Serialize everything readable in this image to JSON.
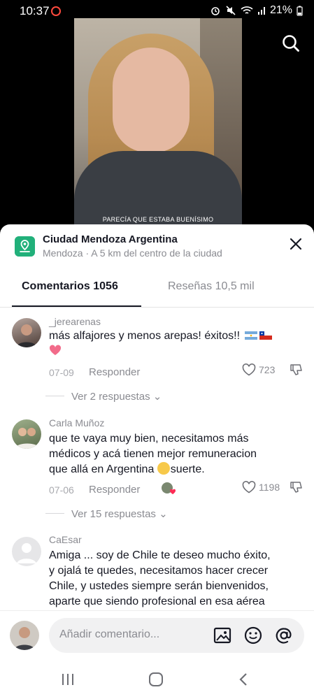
{
  "status_bar": {
    "time": "10:37",
    "battery": "21%"
  },
  "video": {
    "caption": "PARECÍA QUE ESTABA BUENÍSIMO"
  },
  "location": {
    "title": "Ciudad Mendoza Argentina",
    "subtitle": "Mendoza · A 5 km del centro de la ciudad"
  },
  "tabs": [
    {
      "label": "Comentarios 1056",
      "active": true
    },
    {
      "label": "Reseñas 10,5 mil",
      "active": false
    }
  ],
  "comments": [
    {
      "username": "_jerearenas",
      "text": "más alfajores y menos arepas! éxitos!!",
      "date": "07-09",
      "reply_label": "Responder",
      "likes": "723",
      "view_replies": "Ver 2 respuestas"
    },
    {
      "username": "Carla Muñoz",
      "text_line1": "que te vaya muy bien, necesitamos más",
      "text_line2": "médicos y acá tienen mejor remuneracion",
      "text_line3": "que allá en Argentina",
      "text_line3_end": "suerte.",
      "date": "07-06",
      "reply_label": "Responder",
      "likes": "1198",
      "view_replies": "Ver 15 respuestas"
    },
    {
      "username": "CaEsar",
      "text_line1": "Amiga ... soy de Chile te deseo mucho éxito,",
      "text_line2": "y ojalá te quedes, necesitamos hacer crecer",
      "text_line3": "Chile, y ustedes siempre serán bienvenidos,",
      "text_line4": "aparte que siendo profesional en esa aérea"
    }
  ],
  "comment_input": {
    "placeholder": "Añadir comentario..."
  },
  "icons": [
    "search-icon",
    "close-icon",
    "location-pin-icon",
    "heart-icon",
    "dislike-icon",
    "image-icon",
    "emoji-icon",
    "mention-icon",
    "recents-icon",
    "home-icon",
    "back-icon"
  ],
  "colors": {
    "accent_green": "#21b07a",
    "text_primary": "#161823",
    "text_secondary": "#8a8b91"
  }
}
